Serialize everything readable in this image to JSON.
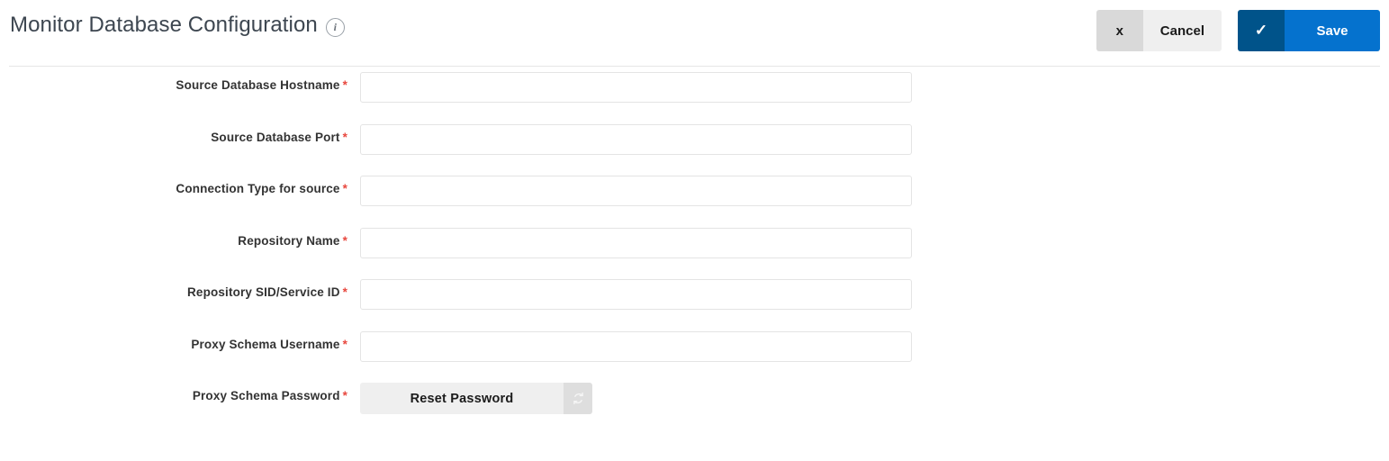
{
  "header": {
    "title": "Monitor Database Configuration",
    "info_icon": "info-circle-icon",
    "actions": [
      {
        "name": "cancel",
        "icon_glyph": "x",
        "icon_name": "close-icon",
        "label": "Cancel",
        "icon_bg": "#d9d9d9",
        "label_bg": "#efefef",
        "text_color": "#1b1b1b"
      },
      {
        "name": "save",
        "icon_glyph": "✓",
        "icon_name": "check-icon",
        "label": "Save",
        "icon_bg": "#00538a",
        "label_bg": "#0572ce",
        "text_color": "#ffffff"
      }
    ]
  },
  "form": {
    "required_marker": "*",
    "fields": [
      {
        "label": "Source Database Hostname",
        "required": true,
        "type": "text",
        "value": "",
        "placeholder": ""
      },
      {
        "label": "Source Database Port",
        "required": true,
        "type": "text",
        "value": "",
        "placeholder": ""
      },
      {
        "label": "Connection Type for source",
        "required": true,
        "type": "text",
        "value": "",
        "placeholder": ""
      },
      {
        "label": "Repository Name",
        "required": true,
        "type": "text",
        "value": "",
        "placeholder": ""
      },
      {
        "label": "Repository SID/Service ID",
        "required": true,
        "type": "text",
        "value": "",
        "placeholder": ""
      },
      {
        "label": "Proxy Schema Username",
        "required": true,
        "type": "text",
        "value": "",
        "placeholder": ""
      },
      {
        "label": "Proxy Schema Password",
        "required": true,
        "type": "reset-button",
        "button_label": "Reset Password",
        "button_icon": "refresh-icon"
      }
    ]
  },
  "colors": {
    "title_text": "#3d4650",
    "label_text": "#333333",
    "required_asterisk": "#e8483f",
    "input_border": "#e4e4e4",
    "divider": "#e6e6e6",
    "accent_blue": "#0572ce",
    "accent_blue_dark": "#00538a"
  }
}
